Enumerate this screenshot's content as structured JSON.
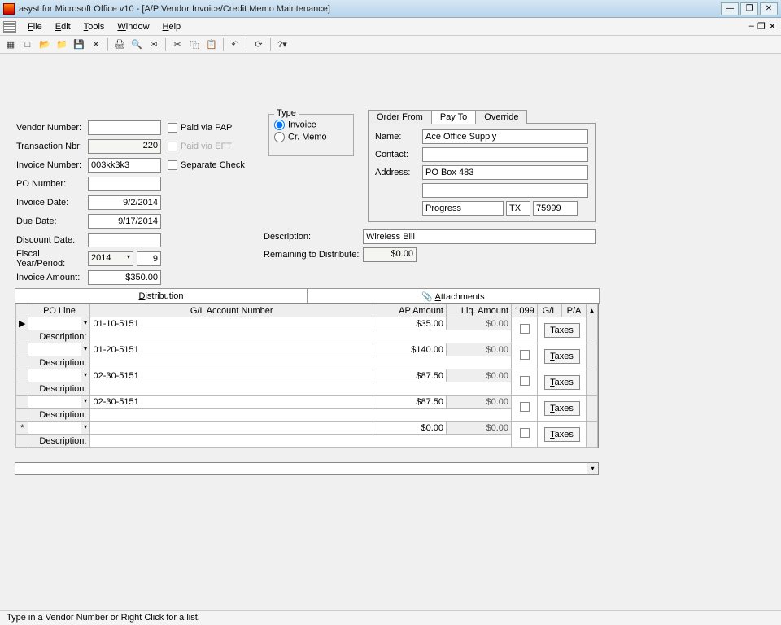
{
  "window": {
    "title": "asyst for Microsoft Office v10 - [A/P Vendor Invoice/Credit Memo Maintenance]"
  },
  "menu": {
    "file": "File",
    "edit": "Edit",
    "tools": "Tools",
    "window": "Window",
    "help": "Help"
  },
  "labels": {
    "vendor_number": "Vendor Number:",
    "transaction_nbr": "Transaction Nbr:",
    "invoice_number": "Invoice Number:",
    "po_number": "PO Number:",
    "invoice_date": "Invoice Date:",
    "due_date": "Due Date:",
    "discount_date": "Discount Date:",
    "fiscal": "Fiscal Year/Period:",
    "invoice_amount": "Invoice Amount:",
    "paid_via_pap": "Paid via PAP",
    "paid_via_eft": "Paid via EFT",
    "separate_check": "Separate Check",
    "description": "Description:",
    "remaining": "Remaining to Distribute:"
  },
  "values": {
    "vendor_number": "",
    "transaction_nbr": "220",
    "invoice_number": "003kk3k3",
    "po_number": "",
    "invoice_date": "9/2/2014",
    "due_date": "9/17/2014",
    "discount_date": "",
    "fiscal_year": "2014",
    "fiscal_period": "9",
    "invoice_amount": "$350.00",
    "description": "Wireless Bill",
    "remaining": "$0.00"
  },
  "type_box": {
    "legend": "Type",
    "invoice": "Invoice",
    "cr_memo": "Cr. Memo"
  },
  "addr_tabs": {
    "order_from": "Order From",
    "pay_to": "Pay To",
    "override": "Override"
  },
  "addr": {
    "name_lbl": "Name:",
    "name": "Ace Office Supply",
    "contact_lbl": "Contact:",
    "contact": "",
    "address_lbl": "Address:",
    "address1": "PO Box 483",
    "address2": "",
    "city": "Progress",
    "state": "TX",
    "zip": "75999"
  },
  "tabs": {
    "distribution": "Distribution",
    "attachments": "Attachments"
  },
  "grid": {
    "headers": {
      "po_line": "PO Line",
      "gl": "G/L Account Number",
      "ap": "AP Amount",
      "liq": "Liq. Amount",
      "c1099": "1099",
      "glbtn": "G/L",
      "pa": "P/A"
    },
    "desc_lbl": "Description:",
    "taxes": "Taxes",
    "rows": [
      {
        "gl": "01-10-5151",
        "ap": "$35.00",
        "liq": "$0.00",
        "desc": ""
      },
      {
        "gl": "01-20-5151",
        "ap": "$140.00",
        "liq": "$0.00",
        "desc": ""
      },
      {
        "gl": "02-30-5151",
        "ap": "$87.50",
        "liq": "$0.00",
        "desc": ""
      },
      {
        "gl": "02-30-5151",
        "ap": "$87.50",
        "liq": "$0.00",
        "desc": ""
      },
      {
        "gl": "",
        "ap": "$0.00",
        "liq": "$0.00",
        "desc": ""
      }
    ]
  },
  "status": "Type in a Vendor Number or Right Click for a list."
}
